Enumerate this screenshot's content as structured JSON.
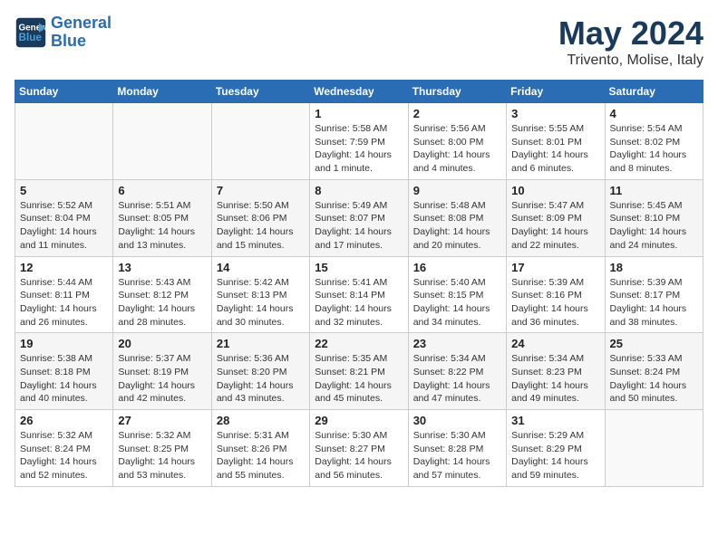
{
  "header": {
    "logo_line1": "General",
    "logo_line2": "Blue",
    "title": "May 2024",
    "subtitle": "Trivento, Molise, Italy"
  },
  "days_of_week": [
    "Sunday",
    "Monday",
    "Tuesday",
    "Wednesday",
    "Thursday",
    "Friday",
    "Saturday"
  ],
  "weeks": [
    [
      {
        "day": "",
        "sunrise": "",
        "sunset": "",
        "daylight": ""
      },
      {
        "day": "",
        "sunrise": "",
        "sunset": "",
        "daylight": ""
      },
      {
        "day": "",
        "sunrise": "",
        "sunset": "",
        "daylight": ""
      },
      {
        "day": "1",
        "sunrise": "Sunrise: 5:58 AM",
        "sunset": "Sunset: 7:59 PM",
        "daylight": "Daylight: 14 hours and 1 minute."
      },
      {
        "day": "2",
        "sunrise": "Sunrise: 5:56 AM",
        "sunset": "Sunset: 8:00 PM",
        "daylight": "Daylight: 14 hours and 4 minutes."
      },
      {
        "day": "3",
        "sunrise": "Sunrise: 5:55 AM",
        "sunset": "Sunset: 8:01 PM",
        "daylight": "Daylight: 14 hours and 6 minutes."
      },
      {
        "day": "4",
        "sunrise": "Sunrise: 5:54 AM",
        "sunset": "Sunset: 8:02 PM",
        "daylight": "Daylight: 14 hours and 8 minutes."
      }
    ],
    [
      {
        "day": "5",
        "sunrise": "Sunrise: 5:52 AM",
        "sunset": "Sunset: 8:04 PM",
        "daylight": "Daylight: 14 hours and 11 minutes."
      },
      {
        "day": "6",
        "sunrise": "Sunrise: 5:51 AM",
        "sunset": "Sunset: 8:05 PM",
        "daylight": "Daylight: 14 hours and 13 minutes."
      },
      {
        "day": "7",
        "sunrise": "Sunrise: 5:50 AM",
        "sunset": "Sunset: 8:06 PM",
        "daylight": "Daylight: 14 hours and 15 minutes."
      },
      {
        "day": "8",
        "sunrise": "Sunrise: 5:49 AM",
        "sunset": "Sunset: 8:07 PM",
        "daylight": "Daylight: 14 hours and 17 minutes."
      },
      {
        "day": "9",
        "sunrise": "Sunrise: 5:48 AM",
        "sunset": "Sunset: 8:08 PM",
        "daylight": "Daylight: 14 hours and 20 minutes."
      },
      {
        "day": "10",
        "sunrise": "Sunrise: 5:47 AM",
        "sunset": "Sunset: 8:09 PM",
        "daylight": "Daylight: 14 hours and 22 minutes."
      },
      {
        "day": "11",
        "sunrise": "Sunrise: 5:45 AM",
        "sunset": "Sunset: 8:10 PM",
        "daylight": "Daylight: 14 hours and 24 minutes."
      }
    ],
    [
      {
        "day": "12",
        "sunrise": "Sunrise: 5:44 AM",
        "sunset": "Sunset: 8:11 PM",
        "daylight": "Daylight: 14 hours and 26 minutes."
      },
      {
        "day": "13",
        "sunrise": "Sunrise: 5:43 AM",
        "sunset": "Sunset: 8:12 PM",
        "daylight": "Daylight: 14 hours and 28 minutes."
      },
      {
        "day": "14",
        "sunrise": "Sunrise: 5:42 AM",
        "sunset": "Sunset: 8:13 PM",
        "daylight": "Daylight: 14 hours and 30 minutes."
      },
      {
        "day": "15",
        "sunrise": "Sunrise: 5:41 AM",
        "sunset": "Sunset: 8:14 PM",
        "daylight": "Daylight: 14 hours and 32 minutes."
      },
      {
        "day": "16",
        "sunrise": "Sunrise: 5:40 AM",
        "sunset": "Sunset: 8:15 PM",
        "daylight": "Daylight: 14 hours and 34 minutes."
      },
      {
        "day": "17",
        "sunrise": "Sunrise: 5:39 AM",
        "sunset": "Sunset: 8:16 PM",
        "daylight": "Daylight: 14 hours and 36 minutes."
      },
      {
        "day": "18",
        "sunrise": "Sunrise: 5:39 AM",
        "sunset": "Sunset: 8:17 PM",
        "daylight": "Daylight: 14 hours and 38 minutes."
      }
    ],
    [
      {
        "day": "19",
        "sunrise": "Sunrise: 5:38 AM",
        "sunset": "Sunset: 8:18 PM",
        "daylight": "Daylight: 14 hours and 40 minutes."
      },
      {
        "day": "20",
        "sunrise": "Sunrise: 5:37 AM",
        "sunset": "Sunset: 8:19 PM",
        "daylight": "Daylight: 14 hours and 42 minutes."
      },
      {
        "day": "21",
        "sunrise": "Sunrise: 5:36 AM",
        "sunset": "Sunset: 8:20 PM",
        "daylight": "Daylight: 14 hours and 43 minutes."
      },
      {
        "day": "22",
        "sunrise": "Sunrise: 5:35 AM",
        "sunset": "Sunset: 8:21 PM",
        "daylight": "Daylight: 14 hours and 45 minutes."
      },
      {
        "day": "23",
        "sunrise": "Sunrise: 5:34 AM",
        "sunset": "Sunset: 8:22 PM",
        "daylight": "Daylight: 14 hours and 47 minutes."
      },
      {
        "day": "24",
        "sunrise": "Sunrise: 5:34 AM",
        "sunset": "Sunset: 8:23 PM",
        "daylight": "Daylight: 14 hours and 49 minutes."
      },
      {
        "day": "25",
        "sunrise": "Sunrise: 5:33 AM",
        "sunset": "Sunset: 8:24 PM",
        "daylight": "Daylight: 14 hours and 50 minutes."
      }
    ],
    [
      {
        "day": "26",
        "sunrise": "Sunrise: 5:32 AM",
        "sunset": "Sunset: 8:24 PM",
        "daylight": "Daylight: 14 hours and 52 minutes."
      },
      {
        "day": "27",
        "sunrise": "Sunrise: 5:32 AM",
        "sunset": "Sunset: 8:25 PM",
        "daylight": "Daylight: 14 hours and 53 minutes."
      },
      {
        "day": "28",
        "sunrise": "Sunrise: 5:31 AM",
        "sunset": "Sunset: 8:26 PM",
        "daylight": "Daylight: 14 hours and 55 minutes."
      },
      {
        "day": "29",
        "sunrise": "Sunrise: 5:30 AM",
        "sunset": "Sunset: 8:27 PM",
        "daylight": "Daylight: 14 hours and 56 minutes."
      },
      {
        "day": "30",
        "sunrise": "Sunrise: 5:30 AM",
        "sunset": "Sunset: 8:28 PM",
        "daylight": "Daylight: 14 hours and 57 minutes."
      },
      {
        "day": "31",
        "sunrise": "Sunrise: 5:29 AM",
        "sunset": "Sunset: 8:29 PM",
        "daylight": "Daylight: 14 hours and 59 minutes."
      },
      {
        "day": "",
        "sunrise": "",
        "sunset": "",
        "daylight": ""
      }
    ]
  ]
}
